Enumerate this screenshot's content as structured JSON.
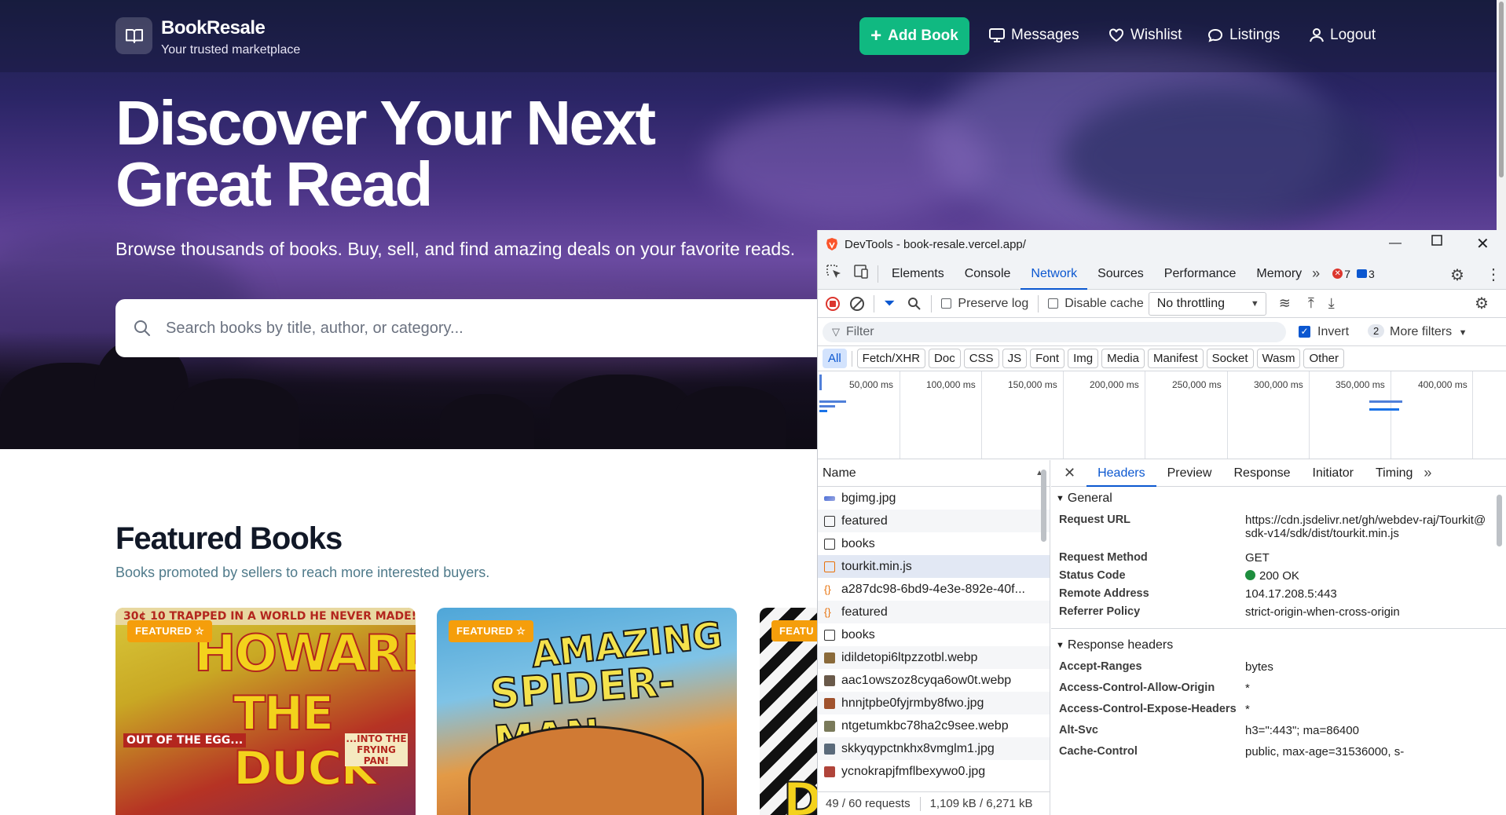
{
  "site": {
    "brand": "BookResale",
    "tagline": "Your trusted marketplace",
    "nav": {
      "add_book": "Add Book",
      "messages": "Messages",
      "wishlist": "Wishlist",
      "listings": "Listings",
      "logout": "Logout"
    },
    "hero": {
      "title_line1": "Discover Your Next",
      "title_line2": "Great Read",
      "subtitle": "Browse thousands of books. Buy, sell, and find amazing deals on your favorite reads.",
      "search_placeholder": "Search books by title, author, or category..."
    },
    "featured": {
      "title": "Featured Books",
      "subtitle": "Books promoted by sellers to reach more interested buyers.",
      "badge": "FEATURED",
      "badge_partial": "FEATU",
      "cards": [
        {
          "cover_top": "30¢ 10 TRAPPED IN A WORLD HE NEVER MADE!",
          "cover_title": "HOWARD",
          "cover_sub": "THE DUCK",
          "cover_extra1": "OUT OF THE EGG...",
          "cover_extra2": "...INTO THE FRYING PAN!"
        },
        {
          "cover_title": "AMAZING",
          "cover_sub": "SPIDER-MAN"
        },
        {
          "cover_title": "D"
        }
      ]
    }
  },
  "devtools": {
    "title": "DevTools - book-resale.vercel.app/",
    "tabs": [
      "Elements",
      "Console",
      "Network",
      "Sources",
      "Performance",
      "Memory"
    ],
    "active_tab": "Network",
    "errors": "7",
    "messages": "3",
    "toolbar": {
      "preserve_log": "Preserve log",
      "disable_cache": "Disable cache",
      "throttling": "No throttling"
    },
    "filter": {
      "placeholder": "Filter",
      "invert": "Invert",
      "more_filters_count": "2",
      "more_filters": "More filters"
    },
    "types": [
      "All",
      "Fetch/XHR",
      "Doc",
      "CSS",
      "JS",
      "Font",
      "Img",
      "Media",
      "Manifest",
      "Socket",
      "Wasm",
      "Other"
    ],
    "timeline_labels": [
      "50,000 ms",
      "100,000 ms",
      "150,000 ms",
      "200,000 ms",
      "250,000 ms",
      "300,000 ms",
      "350,000 ms",
      "400,000 ms"
    ],
    "requests_header": "Name",
    "requests": [
      {
        "name": "bgimg.jpg",
        "icon": "image-icon"
      },
      {
        "name": "featured",
        "icon": "document-icon"
      },
      {
        "name": "books",
        "icon": "document-icon"
      },
      {
        "name": "tourkit.min.js",
        "icon": "script-icon"
      },
      {
        "name": "a287dc98-6bd9-4e3e-892e-40f...",
        "icon": "fetch-icon"
      },
      {
        "name": "featured",
        "icon": "fetch-icon"
      },
      {
        "name": "books",
        "icon": "document-icon"
      },
      {
        "name": "idildetopi6ltpzzotbl.webp",
        "icon": "image-icon"
      },
      {
        "name": "aac1owszoz8cyqa6ow0t.webp",
        "icon": "image-icon"
      },
      {
        "name": "hnnjtpbe0fyjrmby8fwo.jpg",
        "icon": "image-icon"
      },
      {
        "name": "ntgetumkbc78ha2c9see.webp",
        "icon": "image-icon"
      },
      {
        "name": "skkyqypctnkhx8vmglm1.jpg",
        "icon": "image-icon"
      },
      {
        "name": "ycnokrapjfmflbexywo0.jpg",
        "icon": "image-icon"
      }
    ],
    "status": {
      "requests": "49 / 60 requests",
      "transferred": "1,109 kB / 6,271 kB"
    },
    "detail_tabs": [
      "Headers",
      "Preview",
      "Response",
      "Initiator",
      "Timing"
    ],
    "active_detail_tab": "Headers",
    "general": {
      "title": "General",
      "rows": [
        {
          "k": "Request URL",
          "v": "https://cdn.jsdelivr.net/gh/webdev-raj/Tourkit@sdk-v14/sdk/dist/tourkit.min.js"
        },
        {
          "k": "Request Method",
          "v": "GET"
        },
        {
          "k": "Status Code",
          "v": "200 OK"
        },
        {
          "k": "Remote Address",
          "v": "104.17.208.5:443"
        },
        {
          "k": "Referrer Policy",
          "v": "strict-origin-when-cross-origin"
        }
      ]
    },
    "response_headers": {
      "title": "Response headers",
      "rows": [
        {
          "k": "Accept-Ranges",
          "v": "bytes"
        },
        {
          "k": "Access-Control-Allow-Origin",
          "v": "*"
        },
        {
          "k": "Access-Control-Expose-Headers",
          "v": "*"
        },
        {
          "k": "Alt-Svc",
          "v": "h3=\":443\"; ma=86400"
        },
        {
          "k": "Cache-Control",
          "v": "public, max-age=31536000, s-"
        }
      ]
    }
  }
}
